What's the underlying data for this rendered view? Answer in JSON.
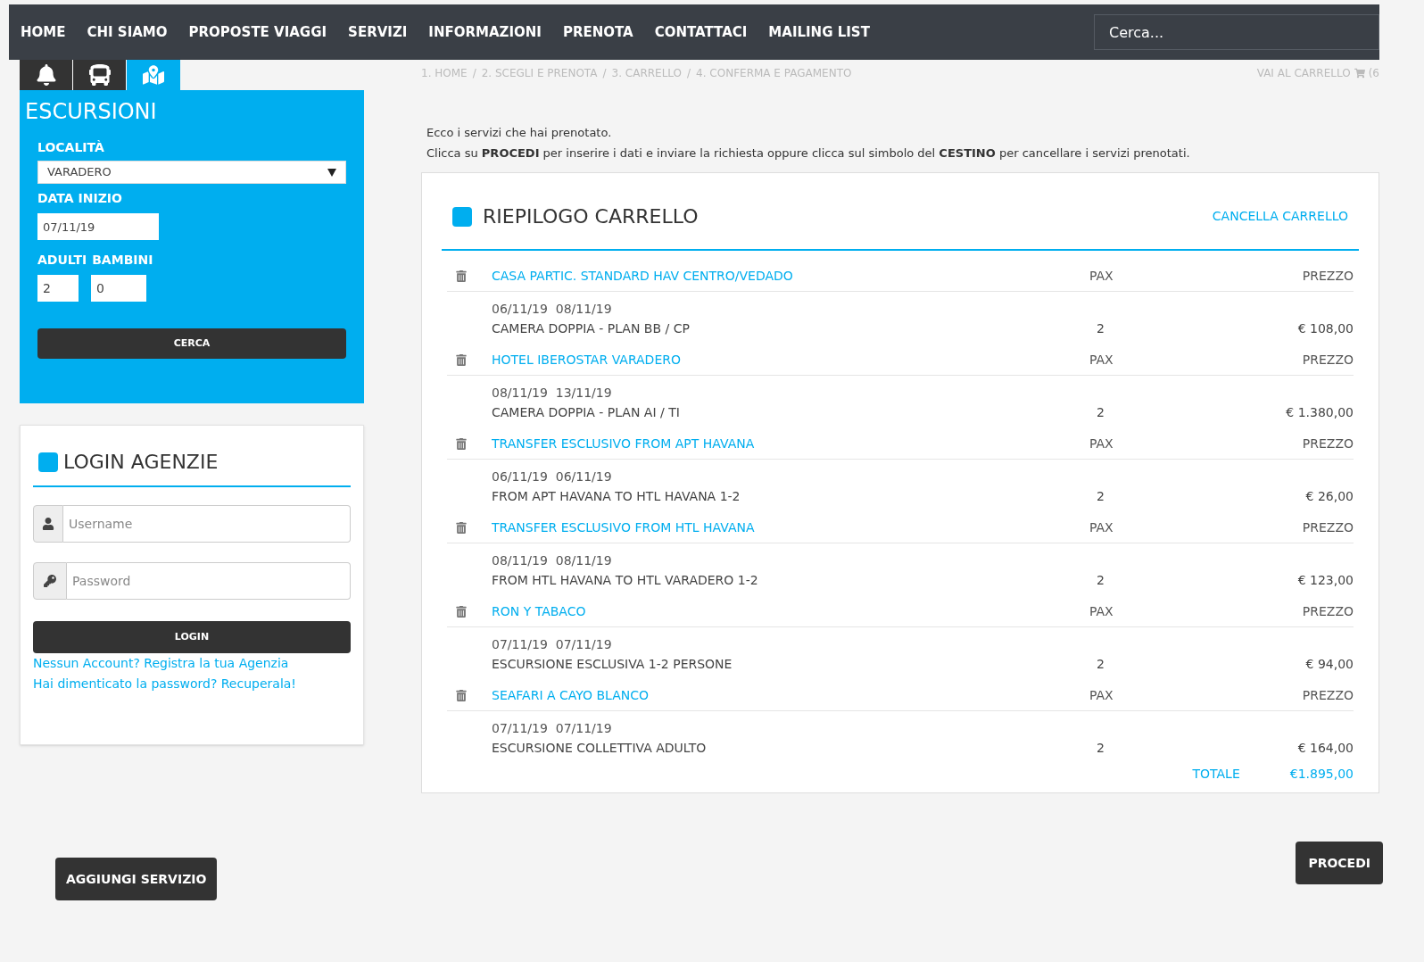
{
  "nav": {
    "items": [
      "HOME",
      "CHI SIAMO",
      "PROPOSTE VIAGGI",
      "SERVIZI",
      "INFORMAZIONI",
      "PRENOTA",
      "CONTATTACI",
      "MAILING LIST"
    ],
    "search": {
      "placeholder": "Cerca..."
    }
  },
  "breadcrumb": {
    "separator": "/",
    "items": [
      "1. HOME",
      "2. SCEGLI E PRENOTA",
      "3. CARRELLO",
      "4. CONFERMA E PAGAMENTO"
    ]
  },
  "cart_link": {
    "label": "VAI AL CARRELLO",
    "count": "(6"
  },
  "search_panel": {
    "tabs": [
      {
        "kind": "bell",
        "selected": false
      },
      {
        "kind": "bus",
        "selected": false
      },
      {
        "kind": "map",
        "selected": true
      }
    ],
    "title": "ESCURSIONI",
    "location_label": "LOCALITÀ",
    "location": "VARADERO",
    "date_label": "DATA INIZIO",
    "date": "07/11/19",
    "adults_label": "ADULTI",
    "children_label": "BAMBINI",
    "adults": "2",
    "children": "0",
    "button": "CERCA"
  },
  "login": {
    "title": "LOGIN AGENZIE",
    "username_placeholder": "Username",
    "password_placeholder": "Password",
    "button": "LOGIN",
    "links": [
      "Nessun Account? Registra la tua Agenzia",
      "Hai dimenticato la password? Recuperala!"
    ]
  },
  "intro": [
    "Ecco i servizi che hai prenotato.",
    "Clicca su **PROCEDI** per inserire i dati e inviare la richiesta oppure clicca sul simbolo del **CESTINO** per cancellare i servizi prenotati."
  ],
  "cart": {
    "title": "RIEPILOGO CARRELLO",
    "clear": "CANCELLA CARRELLO",
    "items": [
      {
        "name": "CASA PARTIC. STANDARD HAV CENTRO/VEDADO",
        "pax_label": "PAX",
        "price_label": "PREZZO",
        "dates": "06/11/19  08/11/19",
        "description": "CAMERA DOPPIA - PLAN BB / CP",
        "pax": "2",
        "price": "€ 108,00"
      },
      {
        "name": "HOTEL IBEROSTAR VARADERO",
        "pax_label": "PAX",
        "price_label": "PREZZO",
        "dates": "08/11/19  13/11/19",
        "description": "CAMERA DOPPIA - PLAN AI / TI",
        "pax": "2",
        "price": "€ 1.380,00"
      },
      {
        "name": "TRANSFER ESCLUSIVO FROM APT HAVANA",
        "pax_label": "PAX",
        "price_label": "PREZZO",
        "dates": "06/11/19  06/11/19",
        "description": "FROM APT HAVANA TO HTL HAVANA 1-2",
        "pax": "2",
        "price": "€ 26,00"
      },
      {
        "name": "TRANSFER ESCLUSIVO FROM HTL HAVANA",
        "pax_label": "PAX",
        "price_label": "PREZZO",
        "dates": "08/11/19  08/11/19",
        "description": "FROM HTL HAVANA TO HTL VARADERO 1-2",
        "pax": "2",
        "price": "€ 123,00"
      },
      {
        "name": "RON Y TABACO",
        "pax_label": "PAX",
        "price_label": "PREZZO",
        "dates": "07/11/19  07/11/19",
        "description": "ESCURSIONE ESCLUSIVA 1-2 PERSONE",
        "pax": "2",
        "price": "€ 94,00"
      },
      {
        "name": "SEAFARI A CAYO BLANCO",
        "pax_label": "PAX",
        "price_label": "PREZZO",
        "dates": "07/11/19  07/11/19",
        "description": "ESCURSIONE COLLETTIVA ADULTO",
        "pax": "2",
        "price": "€ 164,00"
      }
    ],
    "total_label": "TOTALE",
    "total": "€1.895,00"
  },
  "buttons": {
    "add": "AGGIUNGI SERVIZIO",
    "proceed": "PROCEDI"
  }
}
